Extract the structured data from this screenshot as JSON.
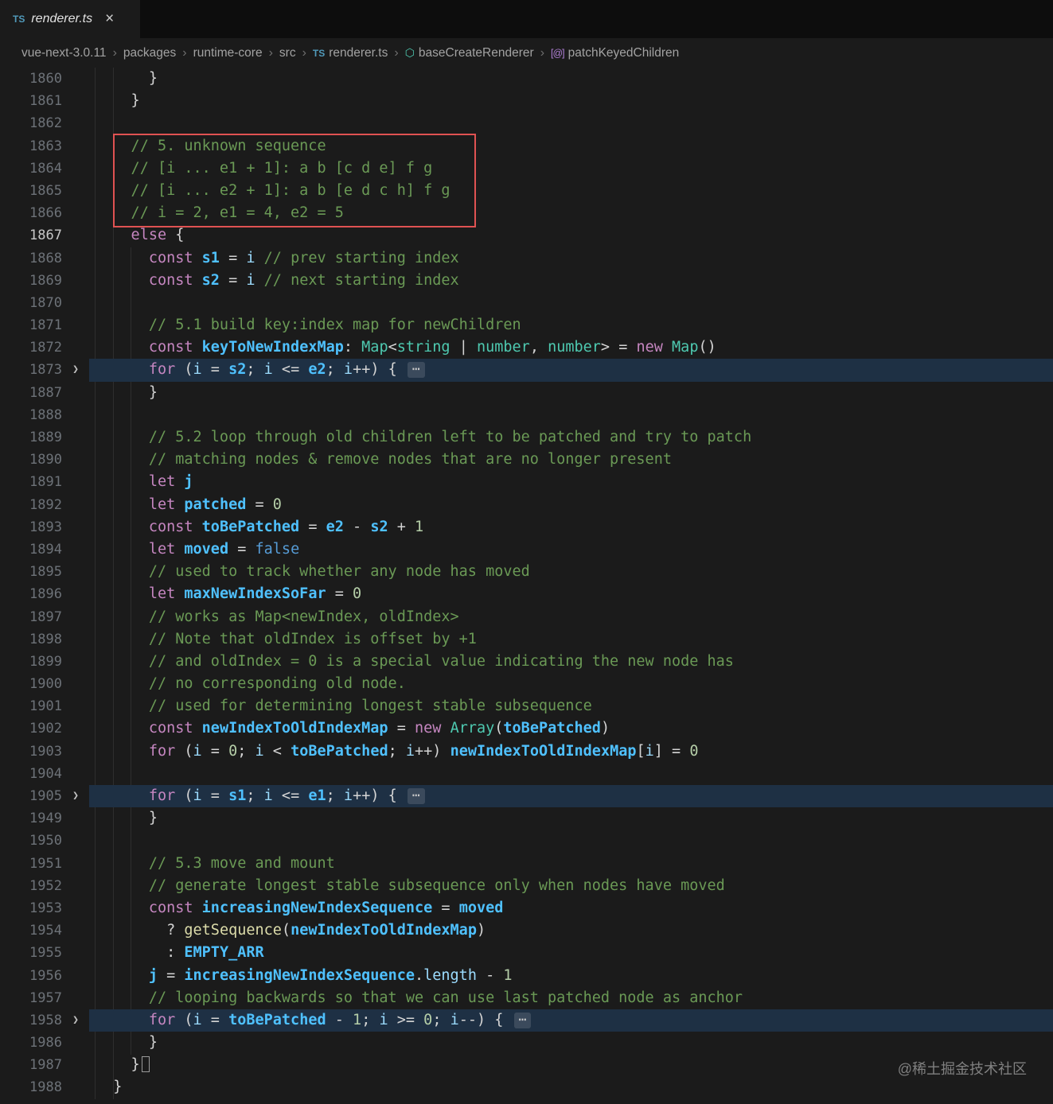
{
  "tab": {
    "file_type_icon": "TS",
    "label": "renderer.ts",
    "close_glyph": "×"
  },
  "breadcrumb_separator": "›",
  "breadcrumbs": [
    {
      "label": "vue-next-3.0.11"
    },
    {
      "label": "packages"
    },
    {
      "label": "runtime-core"
    },
    {
      "label": "src"
    },
    {
      "label": "renderer.ts",
      "icon": {
        "glyph": "TS",
        "cls": "ic-ts",
        "name": "typescript-file-icon"
      }
    },
    {
      "label": "baseCreateRenderer",
      "icon": {
        "glyph": "⬡",
        "cls": "ic-sym",
        "name": "symbol-function-icon"
      }
    },
    {
      "label": "patchKeyedChildren",
      "icon": {
        "glyph": "[@]",
        "cls": "ic-method",
        "name": "symbol-method-icon"
      }
    }
  ],
  "editor": {
    "watermark": "@稀土掘金技术社区",
    "fold_chevron_glyph": "❯",
    "lines": [
      {
        "num": "1860",
        "tokens": [
          [
            "p",
            "      }"
          ]
        ]
      },
      {
        "num": "1861",
        "tokens": [
          [
            "p",
            "    }"
          ]
        ]
      },
      {
        "num": "1862",
        "tokens": []
      },
      {
        "num": "1863",
        "tokens": [
          [
            "c",
            "    // 5. unknown sequence"
          ]
        ]
      },
      {
        "num": "1864",
        "tokens": [
          [
            "c",
            "    // [i ... e1 + 1]: a b [c d e] f g"
          ]
        ]
      },
      {
        "num": "1865",
        "tokens": [
          [
            "c",
            "    // [i ... e2 + 1]: a b [e d c h] f g"
          ]
        ]
      },
      {
        "num": "1866",
        "tokens": [
          [
            "c",
            "    // i = 2, e1 = 4, e2 = 5"
          ]
        ]
      },
      {
        "num": "1867",
        "current": true,
        "tokens": [
          [
            "k",
            "    else"
          ],
          [
            "p",
            " {"
          ]
        ]
      },
      {
        "num": "1868",
        "tokens": [
          [
            "k",
            "      const"
          ],
          [
            "p",
            " "
          ],
          [
            "v",
            "s1"
          ],
          [
            "p",
            " = "
          ],
          [
            "i",
            "i"
          ],
          [
            "p",
            " "
          ],
          [
            "c",
            "// prev starting index"
          ]
        ]
      },
      {
        "num": "1869",
        "tokens": [
          [
            "k",
            "      const"
          ],
          [
            "p",
            " "
          ],
          [
            "v",
            "s2"
          ],
          [
            "p",
            " = "
          ],
          [
            "i",
            "i"
          ],
          [
            "p",
            " "
          ],
          [
            "c",
            "// next starting index"
          ]
        ]
      },
      {
        "num": "1870",
        "tokens": []
      },
      {
        "num": "1871",
        "tokens": [
          [
            "c",
            "      // 5.1 build key:index map for newChildren"
          ]
        ]
      },
      {
        "num": "1872",
        "tokens": [
          [
            "k",
            "      const"
          ],
          [
            "p",
            " "
          ],
          [
            "v",
            "keyToNewIndexMap"
          ],
          [
            "p",
            ": "
          ],
          [
            "t",
            "Map"
          ],
          [
            "p",
            "<"
          ],
          [
            "t",
            "string"
          ],
          [
            "p",
            " | "
          ],
          [
            "t",
            "number"
          ],
          [
            "p",
            ", "
          ],
          [
            "t",
            "number"
          ],
          [
            "p",
            "> = "
          ],
          [
            "k",
            "new"
          ],
          [
            "p",
            " "
          ],
          [
            "t",
            "Map"
          ],
          [
            "p",
            "()"
          ]
        ]
      },
      {
        "num": "1873",
        "folded": true,
        "tokens": [
          [
            "k",
            "      for"
          ],
          [
            "p",
            " ("
          ],
          [
            "i",
            "i"
          ],
          [
            "p",
            " = "
          ],
          [
            "v",
            "s2"
          ],
          [
            "p",
            "; "
          ],
          [
            "i",
            "i"
          ],
          [
            "p",
            " <= "
          ],
          [
            "v",
            "e2"
          ],
          [
            "p",
            "; "
          ],
          [
            "i",
            "i"
          ],
          [
            "p",
            "++) { "
          ],
          [
            "e",
            "⋯"
          ]
        ]
      },
      {
        "num": "1887",
        "tokens": [
          [
            "p",
            "      }"
          ]
        ]
      },
      {
        "num": "1888",
        "tokens": []
      },
      {
        "num": "1889",
        "tokens": [
          [
            "c",
            "      // 5.2 loop through old children left to be patched and try to patch"
          ]
        ]
      },
      {
        "num": "1890",
        "tokens": [
          [
            "c",
            "      // matching nodes & remove nodes that are no longer present"
          ]
        ]
      },
      {
        "num": "1891",
        "tokens": [
          [
            "k",
            "      let"
          ],
          [
            "p",
            " "
          ],
          [
            "v",
            "j"
          ]
        ]
      },
      {
        "num": "1892",
        "tokens": [
          [
            "k",
            "      let"
          ],
          [
            "p",
            " "
          ],
          [
            "v",
            "patched"
          ],
          [
            "p",
            " = "
          ],
          [
            "n",
            "0"
          ]
        ]
      },
      {
        "num": "1893",
        "tokens": [
          [
            "k",
            "      const"
          ],
          [
            "p",
            " "
          ],
          [
            "v",
            "toBePatched"
          ],
          [
            "p",
            " = "
          ],
          [
            "v",
            "e2"
          ],
          [
            "p",
            " - "
          ],
          [
            "v",
            "s2"
          ],
          [
            "p",
            " + "
          ],
          [
            "n",
            "1"
          ]
        ]
      },
      {
        "num": "1894",
        "tokens": [
          [
            "k",
            "      let"
          ],
          [
            "p",
            " "
          ],
          [
            "v",
            "moved"
          ],
          [
            "p",
            " = "
          ],
          [
            "b",
            "false"
          ]
        ]
      },
      {
        "num": "1895",
        "tokens": [
          [
            "c",
            "      // used to track whether any node has moved"
          ]
        ]
      },
      {
        "num": "1896",
        "tokens": [
          [
            "k",
            "      let"
          ],
          [
            "p",
            " "
          ],
          [
            "v",
            "maxNewIndexSoFar"
          ],
          [
            "p",
            " = "
          ],
          [
            "n",
            "0"
          ]
        ]
      },
      {
        "num": "1897",
        "tokens": [
          [
            "c",
            "      // works as Map<newIndex, oldIndex>"
          ]
        ]
      },
      {
        "num": "1898",
        "tokens": [
          [
            "c",
            "      // Note that oldIndex is offset by +1"
          ]
        ]
      },
      {
        "num": "1899",
        "tokens": [
          [
            "c",
            "      // and oldIndex = 0 is a special value indicating the new node has"
          ]
        ]
      },
      {
        "num": "1900",
        "tokens": [
          [
            "c",
            "      // no corresponding old node."
          ]
        ]
      },
      {
        "num": "1901",
        "tokens": [
          [
            "c",
            "      // used for determining longest stable subsequence"
          ]
        ]
      },
      {
        "num": "1902",
        "tokens": [
          [
            "k",
            "      const"
          ],
          [
            "p",
            " "
          ],
          [
            "v",
            "newIndexToOldIndexMap"
          ],
          [
            "p",
            " = "
          ],
          [
            "k",
            "new"
          ],
          [
            "p",
            " "
          ],
          [
            "t",
            "Array"
          ],
          [
            "p",
            "("
          ],
          [
            "v",
            "toBePatched"
          ],
          [
            "p",
            ")"
          ]
        ]
      },
      {
        "num": "1903",
        "tokens": [
          [
            "k",
            "      for"
          ],
          [
            "p",
            " ("
          ],
          [
            "i",
            "i"
          ],
          [
            "p",
            " = "
          ],
          [
            "n",
            "0"
          ],
          [
            "p",
            "; "
          ],
          [
            "i",
            "i"
          ],
          [
            "p",
            " < "
          ],
          [
            "v",
            "toBePatched"
          ],
          [
            "p",
            "; "
          ],
          [
            "i",
            "i"
          ],
          [
            "p",
            "++) "
          ],
          [
            "v",
            "newIndexToOldIndexMap"
          ],
          [
            "p",
            "["
          ],
          [
            "i",
            "i"
          ],
          [
            "p",
            "] = "
          ],
          [
            "n",
            "0"
          ]
        ]
      },
      {
        "num": "1904",
        "tokens": []
      },
      {
        "num": "1905",
        "folded": true,
        "tokens": [
          [
            "k",
            "      for"
          ],
          [
            "p",
            " ("
          ],
          [
            "i",
            "i"
          ],
          [
            "p",
            " = "
          ],
          [
            "v",
            "s1"
          ],
          [
            "p",
            "; "
          ],
          [
            "i",
            "i"
          ],
          [
            "p",
            " <= "
          ],
          [
            "v",
            "e1"
          ],
          [
            "p",
            "; "
          ],
          [
            "i",
            "i"
          ],
          [
            "p",
            "++) { "
          ],
          [
            "e",
            "⋯"
          ]
        ]
      },
      {
        "num": "1949",
        "tokens": [
          [
            "p",
            "      }"
          ]
        ]
      },
      {
        "num": "1950",
        "tokens": []
      },
      {
        "num": "1951",
        "tokens": [
          [
            "c",
            "      // 5.3 move and mount"
          ]
        ]
      },
      {
        "num": "1952",
        "tokens": [
          [
            "c",
            "      // generate longest stable subsequence only when nodes have moved"
          ]
        ]
      },
      {
        "num": "1953",
        "tokens": [
          [
            "k",
            "      const"
          ],
          [
            "p",
            " "
          ],
          [
            "v",
            "increasingNewIndexSequence"
          ],
          [
            "p",
            " = "
          ],
          [
            "v",
            "moved"
          ]
        ]
      },
      {
        "num": "1954",
        "tokens": [
          [
            "p",
            "        ? "
          ],
          [
            "f",
            "getSequence"
          ],
          [
            "p",
            "("
          ],
          [
            "v",
            "newIndexToOldIndexMap"
          ],
          [
            "p",
            ")"
          ]
        ]
      },
      {
        "num": "1955",
        "tokens": [
          [
            "p",
            "        : "
          ],
          [
            "v",
            "EMPTY_ARR"
          ]
        ]
      },
      {
        "num": "1956",
        "tokens": [
          [
            "v",
            "      j"
          ],
          [
            "p",
            " = "
          ],
          [
            "v",
            "increasingNewIndexSequence"
          ],
          [
            "p",
            "."
          ],
          [
            "i",
            "length"
          ],
          [
            "p",
            " - "
          ],
          [
            "n",
            "1"
          ]
        ]
      },
      {
        "num": "1957",
        "tokens": [
          [
            "c",
            "      // looping backwards so that we can use last patched node as anchor"
          ]
        ]
      },
      {
        "num": "1958",
        "folded": true,
        "tokens": [
          [
            "k",
            "      for"
          ],
          [
            "p",
            " ("
          ],
          [
            "i",
            "i"
          ],
          [
            "p",
            " = "
          ],
          [
            "v",
            "toBePatched"
          ],
          [
            "p",
            " - "
          ],
          [
            "n",
            "1"
          ],
          [
            "p",
            "; "
          ],
          [
            "i",
            "i"
          ],
          [
            "p",
            " >= "
          ],
          [
            "n",
            "0"
          ],
          [
            "p",
            "; "
          ],
          [
            "i",
            "i"
          ],
          [
            "p",
            "--) { "
          ],
          [
            "e",
            "⋯"
          ]
        ]
      },
      {
        "num": "1986",
        "tokens": [
          [
            "p",
            "      }"
          ]
        ]
      },
      {
        "num": "1987",
        "cursor": true,
        "tokens": [
          [
            "p",
            "    }"
          ]
        ]
      },
      {
        "num": "1988",
        "tokens": [
          [
            "p",
            "  }"
          ]
        ]
      }
    ]
  },
  "colors": {
    "bg-editor": "#1b1b1b",
    "bg-tabbar": "#0d0d0d",
    "bg-tab-active": "#1b1b1b",
    "bg-folded-line": "#1e3044",
    "comment": "#6a9955",
    "keyword": "#c586c0",
    "variable": "#4fc1ff",
    "identifier": "#9cdcfe",
    "type": "#4ec9b0",
    "function": "#dcdcaa",
    "number": "#b5cea8",
    "boolean": "#569cd6",
    "plain": "#d4d4d4",
    "line-number": "#6d7278",
    "line-number-active": "#c8c8c8",
    "annotation-red": "#e05252",
    "breadcrumb-text": "#a2a2a2",
    "ts-blue": "#519aba",
    "symbol-purple": "#b180d7",
    "indent-guide": "#2e2e2e",
    "watermark": "#9a9a9a"
  }
}
